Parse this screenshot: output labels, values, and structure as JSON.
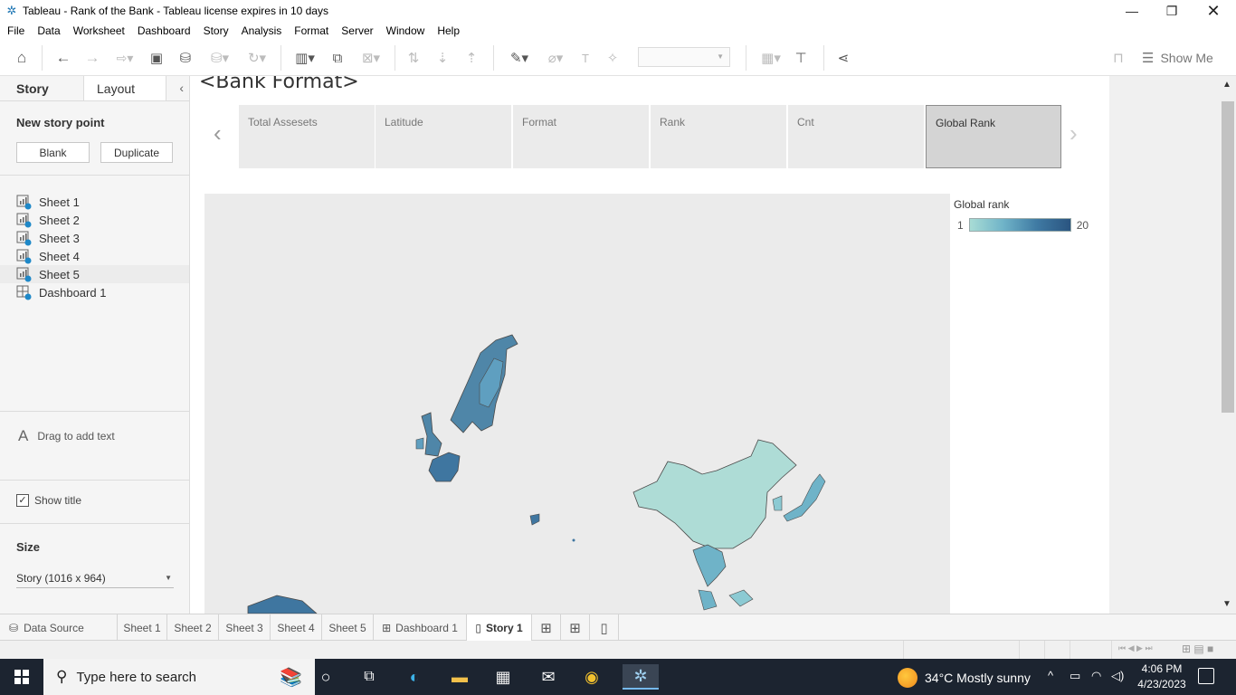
{
  "window": {
    "title": "Tableau - Rank of the Bank - Tableau license expires in 10 days",
    "controls": [
      "minimize-icon",
      "restore-icon",
      "close-icon"
    ]
  },
  "menu": [
    "File",
    "Data",
    "Worksheet",
    "Dashboard",
    "Story",
    "Analysis",
    "Format",
    "Server",
    "Window",
    "Help"
  ],
  "toolbar": {
    "show_me": "Show Me"
  },
  "left_pane": {
    "tabs": {
      "story": "Story",
      "layout": "Layout"
    },
    "new_story_point": "New story point",
    "blank_button": "Blank",
    "duplicate_button": "Duplicate",
    "sheets": [
      {
        "label": "Sheet 1",
        "icon": "worksheet-icon"
      },
      {
        "label": "Sheet 2",
        "icon": "worksheet-icon"
      },
      {
        "label": "Sheet 3",
        "icon": "worksheet-icon"
      },
      {
        "label": "Sheet 4",
        "icon": "worksheet-icon"
      },
      {
        "label": "Sheet 5",
        "icon": "worksheet-icon"
      },
      {
        "label": "Dashboard 1",
        "icon": "dashboard-icon"
      }
    ],
    "drag_text": "Drag to add text",
    "show_title": "Show title",
    "show_title_checked": true,
    "size_label": "Size",
    "size_value": "Story (1016 x 964)"
  },
  "story": {
    "title": "<Bank Format>",
    "points": [
      "Total Assesets",
      "Latitude",
      "Format",
      "Rank",
      "Cnt",
      "Global Rank"
    ],
    "active_point": "Global Rank"
  },
  "legend": {
    "title": "Global rank",
    "min": "1",
    "max": "20",
    "colors": [
      "#a8dcd5",
      "#2a5480"
    ]
  },
  "bottom_tabs": {
    "data_source": "Data Source",
    "sheets": [
      "Sheet 1",
      "Sheet 2",
      "Sheet 3",
      "Sheet 4",
      "Sheet 5"
    ],
    "dashboard": "Dashboard 1",
    "story": "Story 1"
  },
  "taskbar": {
    "search_placeholder": "Type here to search",
    "weather": "34°C  Mostly sunny",
    "time": "4:06 PM",
    "date": "4/23/2023"
  }
}
